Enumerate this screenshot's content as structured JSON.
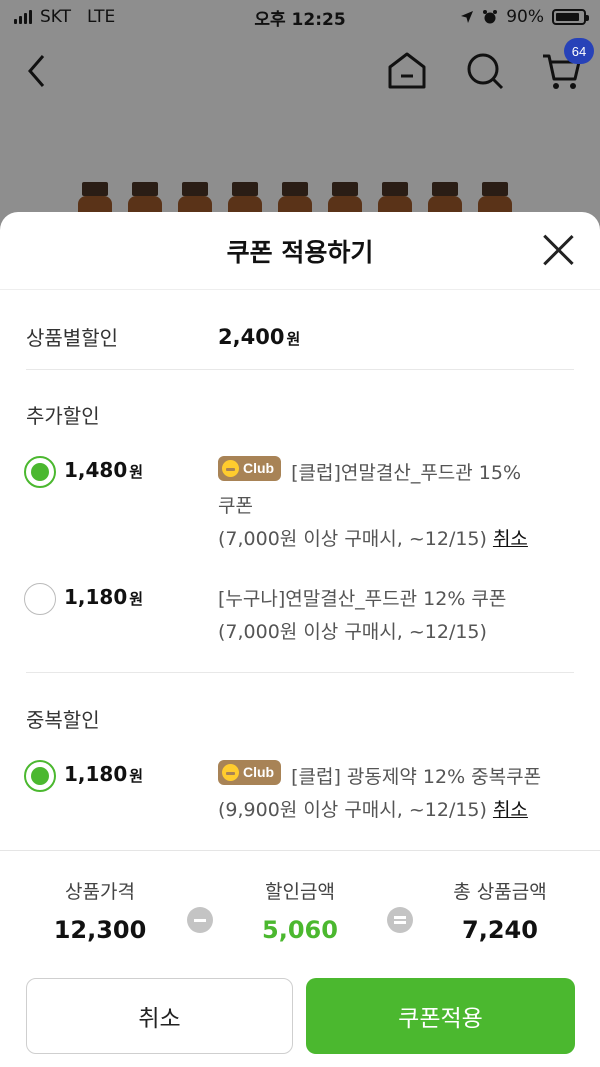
{
  "status_bar": {
    "carrier": "SKT",
    "network": "LTE",
    "time": "오후 12:25",
    "battery": "90%",
    "battery_level": 0.9
  },
  "nav": {
    "cart_count": "64",
    "icons": [
      "back-icon",
      "home-icon",
      "search-icon",
      "cart-icon"
    ]
  },
  "sheet": {
    "title": "쿠폰 적용하기",
    "product_discount": {
      "label": "상품별할인",
      "amount": "2,400",
      "unit": "원"
    },
    "additional": {
      "title": "추가할인",
      "options": [
        {
          "amount": "1,480",
          "unit": "원",
          "selected": true,
          "badge": "Club",
          "line1": "[클럽]연말결산_푸드관 15%",
          "line2": "쿠폰",
          "line3": "(7,000원 이상 구매시, ~12/15)",
          "cancel": "취소"
        },
        {
          "amount": "1,180",
          "unit": "원",
          "selected": false,
          "line1": "[누구나]연말결산_푸드관 12% 쿠폰",
          "line2": "(7,000원 이상 구매시, ~12/15)"
        }
      ]
    },
    "duplicate": {
      "title": "중복할인",
      "option": {
        "amount": "1,180",
        "unit": "원",
        "selected": true,
        "badge": "Club",
        "line1": "[클럽] 광동제약 12% 중복쿠폰",
        "line2": "(9,900원 이상 구매시, ~12/15)",
        "cancel": "취소"
      }
    },
    "summary": {
      "price_label": "상품가격",
      "price": "12,300",
      "discount_label": "할인금액",
      "discount": "5,060",
      "total_label": "총 상품금액",
      "total": "7,240"
    },
    "buttons": {
      "cancel": "취소",
      "apply": "쿠폰적용"
    }
  },
  "colors": {
    "accent_green": "#4bb82f",
    "club_badge": "#a88356",
    "cart_badge": "#2742b8",
    "overlay": "#8e8e8e"
  }
}
